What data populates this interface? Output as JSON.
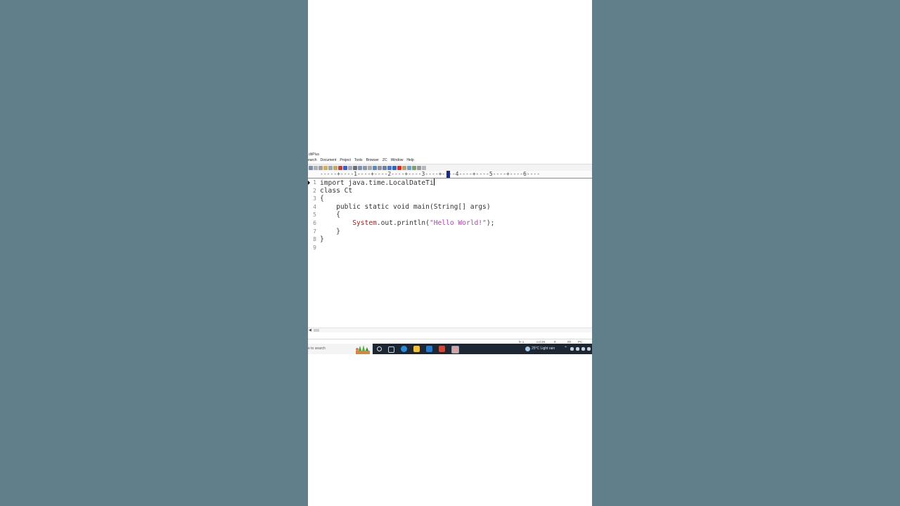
{
  "app": {
    "title": "ditPlus",
    "menu": [
      "earch",
      "Document",
      "Project",
      "Tools",
      "Browser",
      "ZC",
      "Window",
      "Help"
    ]
  },
  "ruler": {
    "text": "-----+----1----+----2----+----3----+----4----+----5----+----6----"
  },
  "editor": {
    "line_numbers": [
      "1",
      "2",
      "3",
      "4",
      "5",
      "6",
      "7",
      "8",
      "9"
    ],
    "lines": [
      "import java.time.LocalDateTi",
      "class Ct",
      "{",
      "    public static void main(String[] args)",
      "    {",
      "        System.out.println(\"Hello World!\");",
      "    }",
      "}",
      ""
    ]
  },
  "status": {
    "ln": "ln 1",
    "col": "col 28",
    "num": "9",
    "mode": "00",
    "eol": "PC"
  },
  "taskbar": {
    "search_placeholder": "e to search",
    "weather": "25°C  Light rain"
  },
  "colors": {
    "background": "#607f8b",
    "system_keyword": "#a02020",
    "string_literal": "#b040b0",
    "taskbar": "#1c2733"
  }
}
